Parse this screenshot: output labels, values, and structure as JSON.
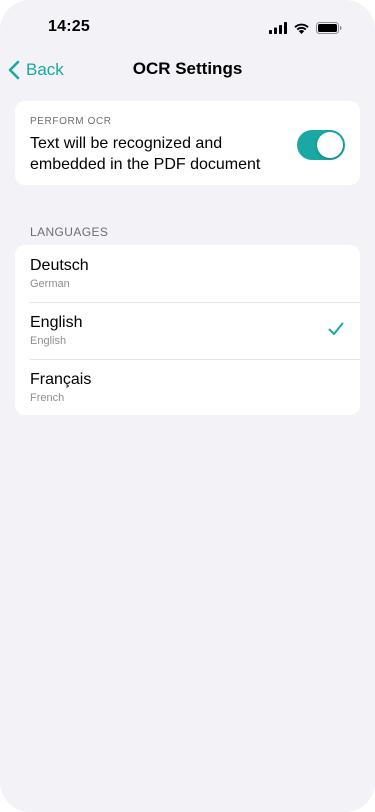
{
  "status_bar": {
    "time": "14:25",
    "icons": [
      "cellular-signal-icon",
      "wifi-icon",
      "battery-icon"
    ]
  },
  "nav": {
    "back_label": "Back",
    "title": "OCR Settings",
    "back_icon": "chevron-left-icon"
  },
  "ocr": {
    "caption": "PERFORM OCR",
    "description": "Text will be recognized and embedded in the PDF document",
    "enabled": true
  },
  "languages": {
    "header": "LANGUAGES",
    "items": [
      {
        "name": "Deutsch",
        "subtitle": "German",
        "selected": false
      },
      {
        "name": "English",
        "subtitle": "English",
        "selected": true
      },
      {
        "name": "Français",
        "subtitle": "French",
        "selected": false
      }
    ],
    "selected_icon": "checkmark-icon"
  },
  "colors": {
    "accent": "#1aa8a2",
    "background": "#f2f2f7",
    "card": "#ffffff",
    "secondary_text": "#6d6d72"
  }
}
